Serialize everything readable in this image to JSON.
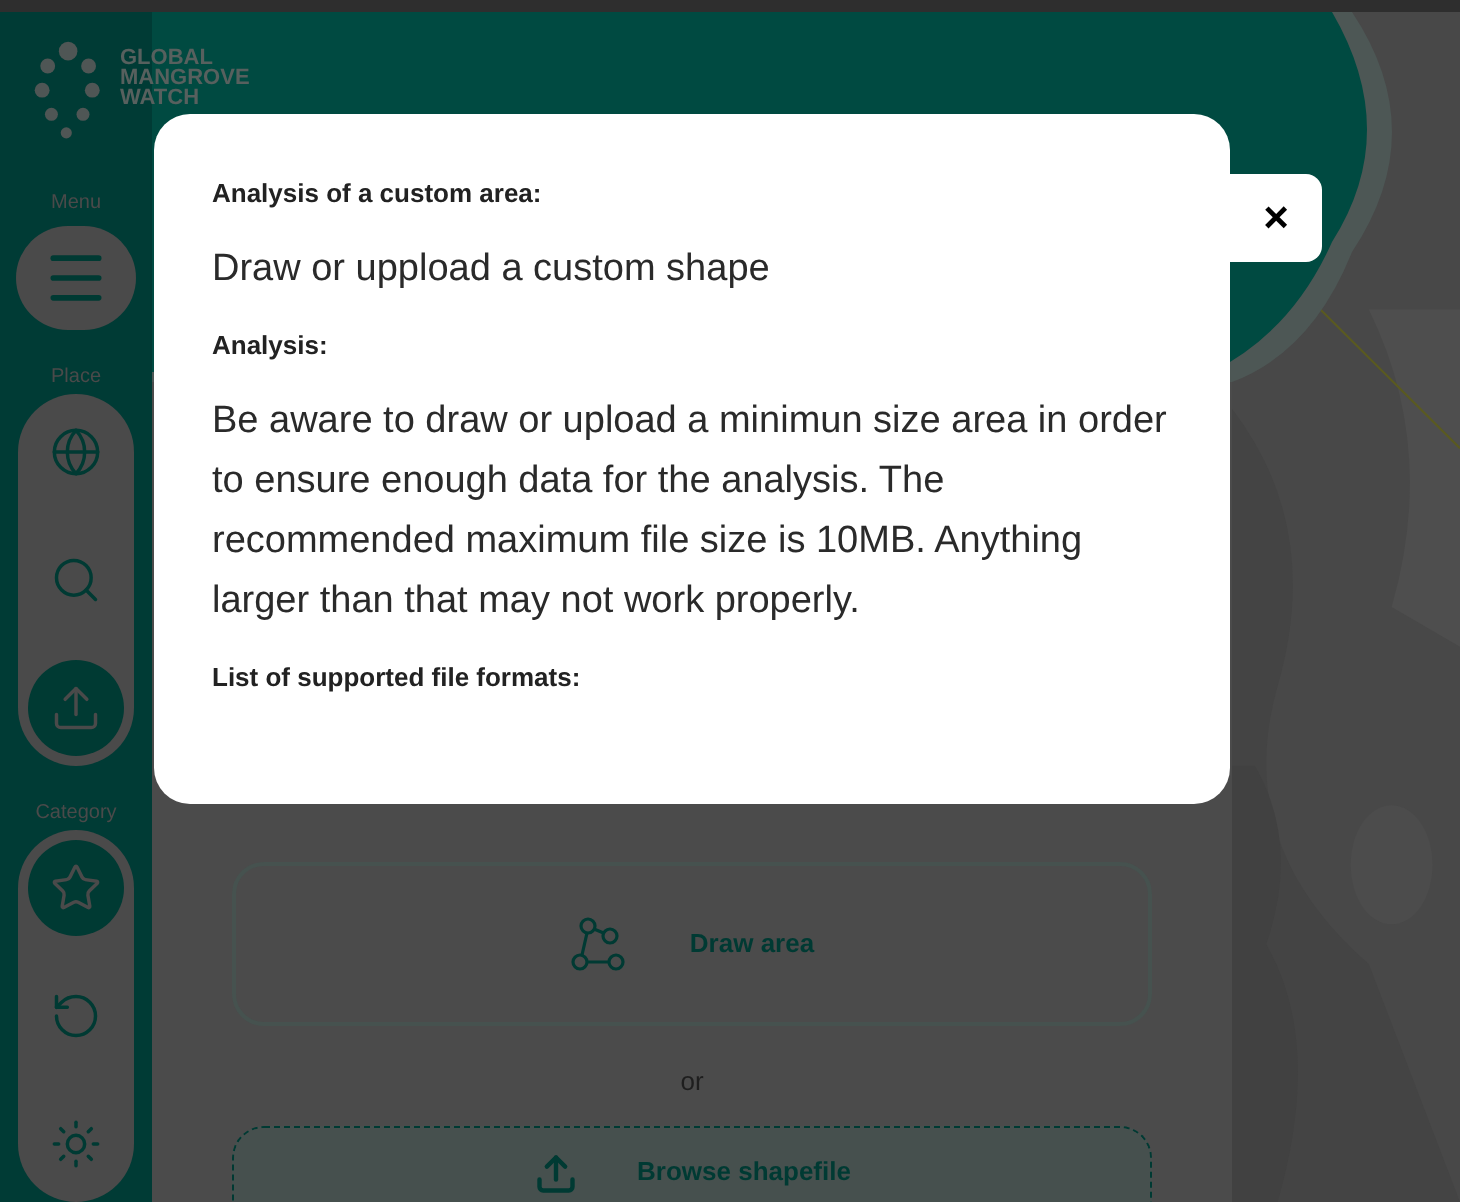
{
  "logo": {
    "lines": [
      "GLOBAL",
      "MANGROVE",
      "WATCH"
    ]
  },
  "sidebar": {
    "menu": {
      "label": "Menu"
    },
    "sections": [
      {
        "label": "Place",
        "items": [
          {
            "kind": "globe",
            "selected": false
          },
          {
            "kind": "search",
            "selected": false
          },
          {
            "kind": "upload",
            "selected": true
          }
        ]
      },
      {
        "label": "Category",
        "items": [
          {
            "kind": "star",
            "selected": true
          },
          {
            "kind": "history",
            "selected": false
          },
          {
            "kind": "sun",
            "selected": false
          }
        ]
      }
    ]
  },
  "panel": {
    "draw_button": "Draw area",
    "separator": "or",
    "browse_button": "Browse shapefile"
  },
  "modal": {
    "sections": [
      {
        "heading": "Analysis of a custom area:",
        "text": "Draw or uppload a custom shape"
      },
      {
        "heading": "Analysis:",
        "text": "Be aware to draw or upload a minimun size area in order to ensure enough data for the analysis. The recommended maximum file size is 10MB. Anything larger than that may not work properly."
      },
      {
        "heading": "List of supported file formats:"
      }
    ],
    "close_label": "×"
  }
}
